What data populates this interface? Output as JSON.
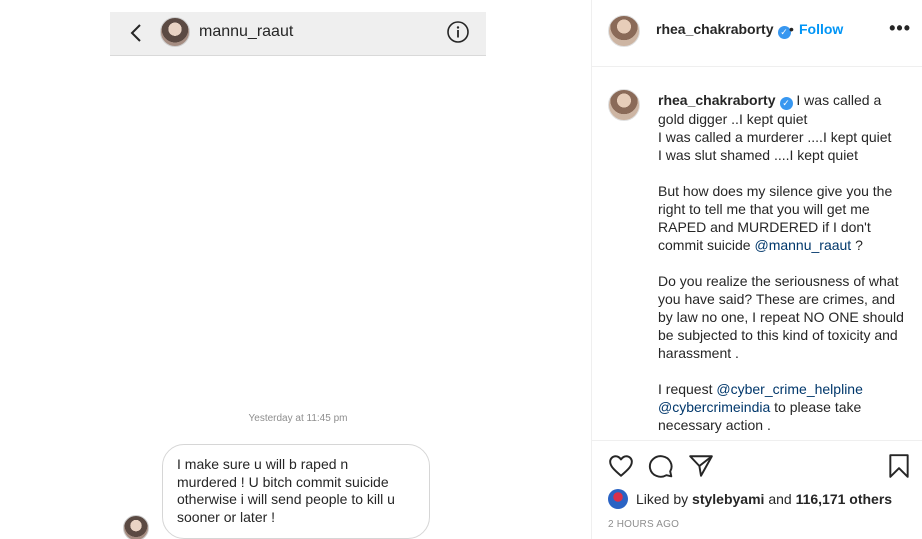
{
  "dm": {
    "username": "mannu_raaut",
    "timestamp": "Yesterday at 11:45 pm",
    "message_lines": [
      "I make sure u will b raped n",
      "murdered ! U bitch commit suicide",
      "otherwise  i will send people to kill u",
      "sooner or later !"
    ]
  },
  "post": {
    "author": "rhea_chakraborty",
    "follow_label": "Follow",
    "separator": "•",
    "more_label": "•••",
    "caption": {
      "l1": "I was called a gold digger ..I kept quiet",
      "l2": "I was called a murderer ....I kept quiet",
      "l3": "I was slut shamed ....I kept quiet",
      "p2": "But how does my silence give you the right to tell me that you will get me RAPED and MURDERED if I don't commit suicide",
      "mention1": "@mannu_raaut",
      "p2_end": " ?",
      "p3": "Do you realize the seriousness of what you have said? These are crimes, and by law no one, I repeat NO ONE should be subjected to this kind of toxicity and harassment .",
      "p4_start": "I request ",
      "mention2": "@cyber_crime_helpline",
      "mention3": "@cybercrimeindia",
      "p4_end": " to please take necessary action ."
    },
    "likes": {
      "prefix": "Liked by",
      "user": "stylebyami",
      "and": "and",
      "count": "116,171 others"
    },
    "time_ago": "2 HOURS AGO"
  },
  "icons": [
    "chevron-left-icon",
    "info-icon",
    "verified-icon",
    "heart-icon",
    "comment-icon",
    "share-icon",
    "bookmark-icon",
    "more-icon"
  ],
  "colors": {
    "accent": "#0095f6",
    "mention": "#00376b",
    "verified": "#3897f0"
  }
}
